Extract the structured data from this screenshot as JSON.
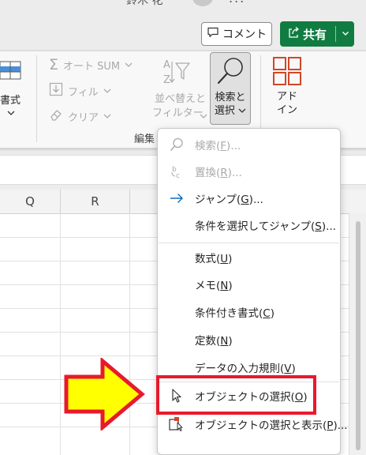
{
  "title": {
    "user_name": "鈴木 花",
    "more": "..."
  },
  "header": {
    "comment_label": "コメント",
    "share_label": "共有"
  },
  "ribbon": {
    "format_label": "書式",
    "autosum_label": "オート SUM",
    "fill_label": "フィル",
    "clear_label": "クリア",
    "sort_filter_line1": "並べ替えと",
    "sort_filter_line2": "フィルター",
    "find_select_line1": "検索と",
    "find_select_line2": "選択",
    "addins_line1": "アド",
    "addins_line2": "イン",
    "group_label": "編集"
  },
  "sheet": {
    "columns": [
      "Q",
      "R",
      ""
    ]
  },
  "menu": {
    "items": [
      {
        "label": "検索",
        "key": "F",
        "suffix": "...",
        "icon": "magnifier-icon",
        "enabled": false
      },
      {
        "label": "置換",
        "key": "R",
        "suffix": "...",
        "icon": "replace-icon",
        "enabled": false
      },
      {
        "label": "ジャンプ",
        "key": "G",
        "suffix": "...",
        "icon": "arrow-right-icon",
        "enabled": true
      },
      {
        "label": "条件を選択してジャンプ",
        "key": "S",
        "suffix": "...",
        "icon": "",
        "enabled": true
      },
      {
        "label": "数式",
        "key": "U",
        "suffix": "",
        "icon": "",
        "enabled": true
      },
      {
        "label": "メモ",
        "key": "N",
        "suffix": "",
        "icon": "",
        "enabled": true
      },
      {
        "label": "条件付き書式",
        "key": "C",
        "suffix": "",
        "icon": "",
        "enabled": true
      },
      {
        "label": "定数",
        "key": "N",
        "suffix": "",
        "icon": "",
        "enabled": true
      },
      {
        "label": "データの入力規則",
        "key": "V",
        "suffix": "",
        "icon": "",
        "enabled": true
      },
      {
        "label": "オブジェクトの選択",
        "key": "O",
        "suffix": "",
        "icon": "cursor-pointer-icon",
        "enabled": true
      },
      {
        "label": "オブジェクトの選択と表示",
        "key": "P",
        "suffix": "...",
        "icon": "selection-pane-icon",
        "enabled": true
      }
    ]
  },
  "colors": {
    "accent_green": "#107c41",
    "highlight_red": "#e8192c",
    "arrow_yellow": "#ffff00",
    "addin_orange": "#d24726",
    "link_blue": "#0f6cbd"
  }
}
